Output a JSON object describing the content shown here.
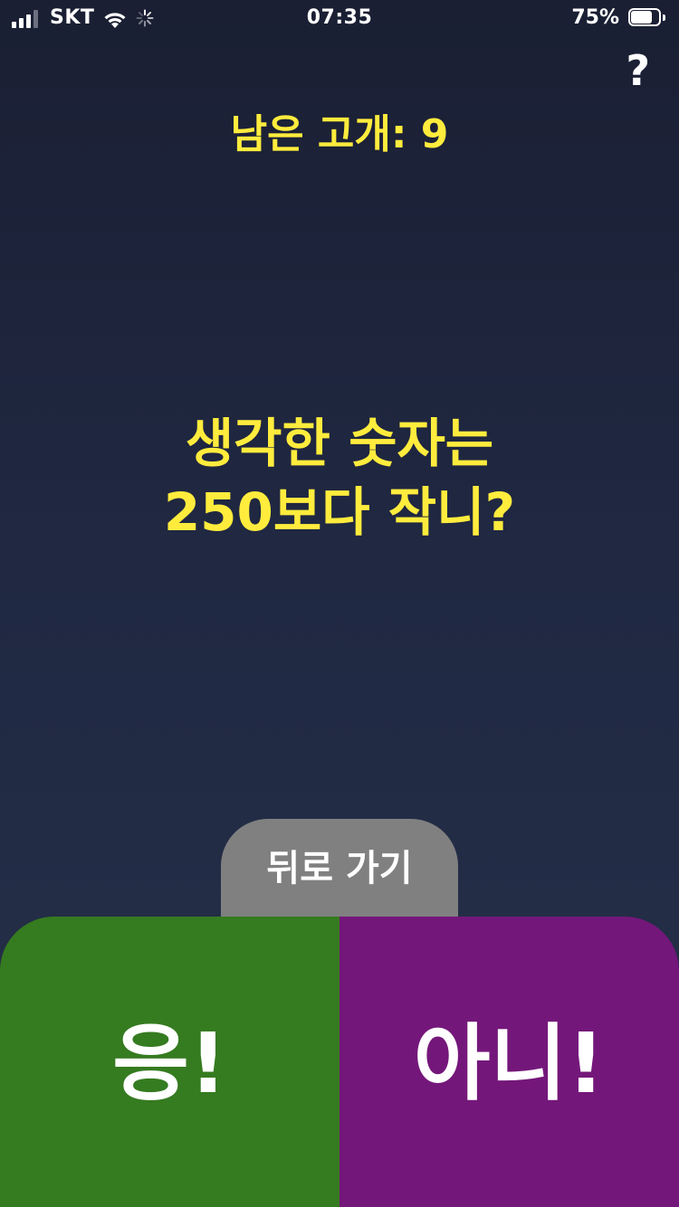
{
  "status_bar": {
    "carrier": "SKT",
    "time": "07:35",
    "battery_percent": "75%",
    "battery_level": 0.75,
    "signal_bars": 3,
    "signal_bars_total": 4,
    "icons": [
      "signal-icon",
      "wifi-icon",
      "loading-spinner-icon",
      "battery-icon"
    ]
  },
  "header": {
    "help_label": "?",
    "remaining_text": "남은 고개: 9"
  },
  "question": {
    "line1": "생각한 숫자는",
    "line2": "250보다 작니?"
  },
  "controls": {
    "back_label": "뒤로 가기",
    "yes_label": "응!",
    "no_label": "아니!"
  },
  "colors": {
    "background_top": "#1a1f33",
    "background_bottom": "#253149",
    "accent_text": "#ffec3d",
    "back_button": "#808080",
    "yes_button": "#357b20",
    "no_button": "#74177a"
  }
}
